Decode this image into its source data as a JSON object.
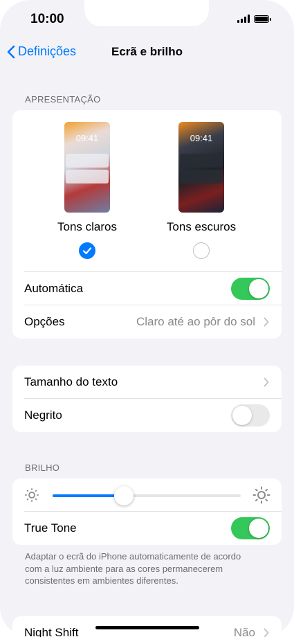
{
  "status_bar": {
    "time": "10:00"
  },
  "nav": {
    "back_label": "Definições",
    "title": "Ecrã e brilho"
  },
  "appearance": {
    "header": "APRESENTAÇÃO",
    "light": {
      "preview_time": "09:41",
      "label": "Tons claros",
      "selected": true
    },
    "dark": {
      "preview_time": "09:41",
      "label": "Tons escuros",
      "selected": false
    },
    "automatic": {
      "label": "Automática",
      "on": true
    },
    "options": {
      "label": "Opções",
      "value": "Claro até ao pôr do sol"
    }
  },
  "text": {
    "size_label": "Tamanho do texto",
    "bold": {
      "label": "Negrito",
      "on": false
    }
  },
  "brightness": {
    "header": "BRILHO",
    "level": 0.38,
    "true_tone": {
      "label": "True Tone",
      "on": true
    },
    "footnote": "Adaptar o ecrã do iPhone automaticamente de acordo com a luz ambiente para as cores permanecerem consistentes em ambientes diferentes."
  },
  "night_shift": {
    "label": "Night Shift",
    "value": "Não"
  },
  "colors": {
    "accent": "#007aff",
    "toggle_on": "#34c759",
    "toggle_off": "#e9e9ea"
  }
}
